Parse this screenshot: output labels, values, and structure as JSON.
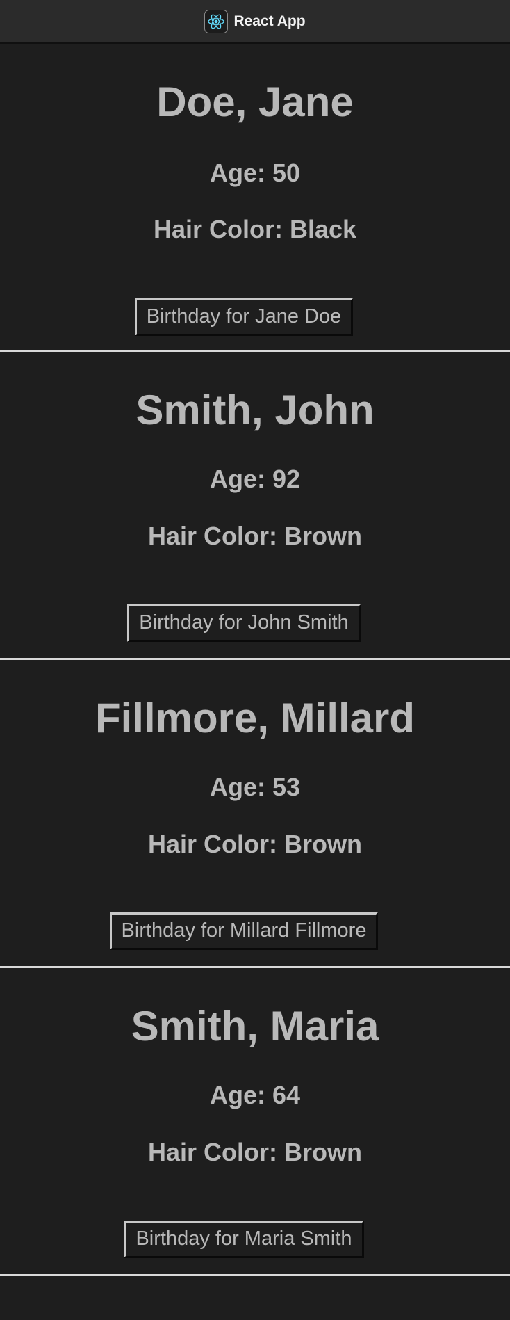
{
  "window": {
    "title": "React App",
    "icon": "react-logo-icon",
    "accent": "#61dafb"
  },
  "people": [
    {
      "name": "Doe, Jane",
      "age": "Age: 50",
      "hair": "Hair Color: Black",
      "button_label": "Birthday for Jane Doe"
    },
    {
      "name": "Smith, John",
      "age": "Age: 92",
      "hair": "Hair Color: Brown",
      "button_label": "Birthday for John Smith"
    },
    {
      "name": "Fillmore, Millard",
      "age": "Age: 53",
      "hair": "Hair Color: Brown",
      "button_label": "Birthday for Millard Fillmore"
    },
    {
      "name": "Smith, Maria",
      "age": "Age: 64",
      "hair": "Hair Color: Brown",
      "button_label": "Birthday for Maria Smith"
    }
  ]
}
